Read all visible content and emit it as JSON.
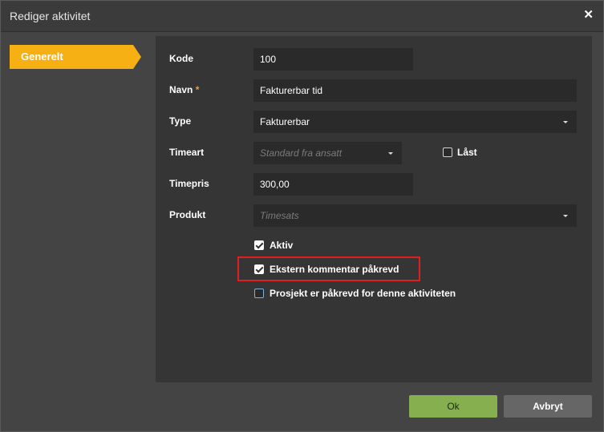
{
  "dialog": {
    "title": "Rediger aktivitet"
  },
  "tabs": [
    {
      "label": "Generelt",
      "active": true
    }
  ],
  "form": {
    "kode": {
      "label": "Kode",
      "value": "100"
    },
    "navn": {
      "label": "Navn",
      "required_mark": "*",
      "value": "Fakturerbar tid"
    },
    "type": {
      "label": "Type",
      "value": "Fakturerbar"
    },
    "timeart": {
      "label": "Timeart",
      "placeholder": "Standard fra ansatt"
    },
    "laast": {
      "label": "Låst",
      "checked": false
    },
    "timepris": {
      "label": "Timepris",
      "value": "300,00"
    },
    "produkt": {
      "label": "Produkt",
      "placeholder": "Timesats"
    },
    "aktiv": {
      "label": "Aktiv",
      "checked": true
    },
    "ekstern": {
      "label": "Ekstern kommentar påkrevd",
      "checked": true
    },
    "prosjekt": {
      "label": "Prosjekt er påkrevd for denne aktiviteten",
      "checked": false
    }
  },
  "buttons": {
    "ok": "Ok",
    "cancel": "Avbryt"
  },
  "colors": {
    "accent_tab": "#f7b014",
    "ok_button": "#86b04f",
    "highlight": "#e02020",
    "required": "#e8a33d"
  },
  "icons": {
    "close": "close-icon",
    "dropdown": "chevron-down-icon",
    "check": "check-icon"
  }
}
